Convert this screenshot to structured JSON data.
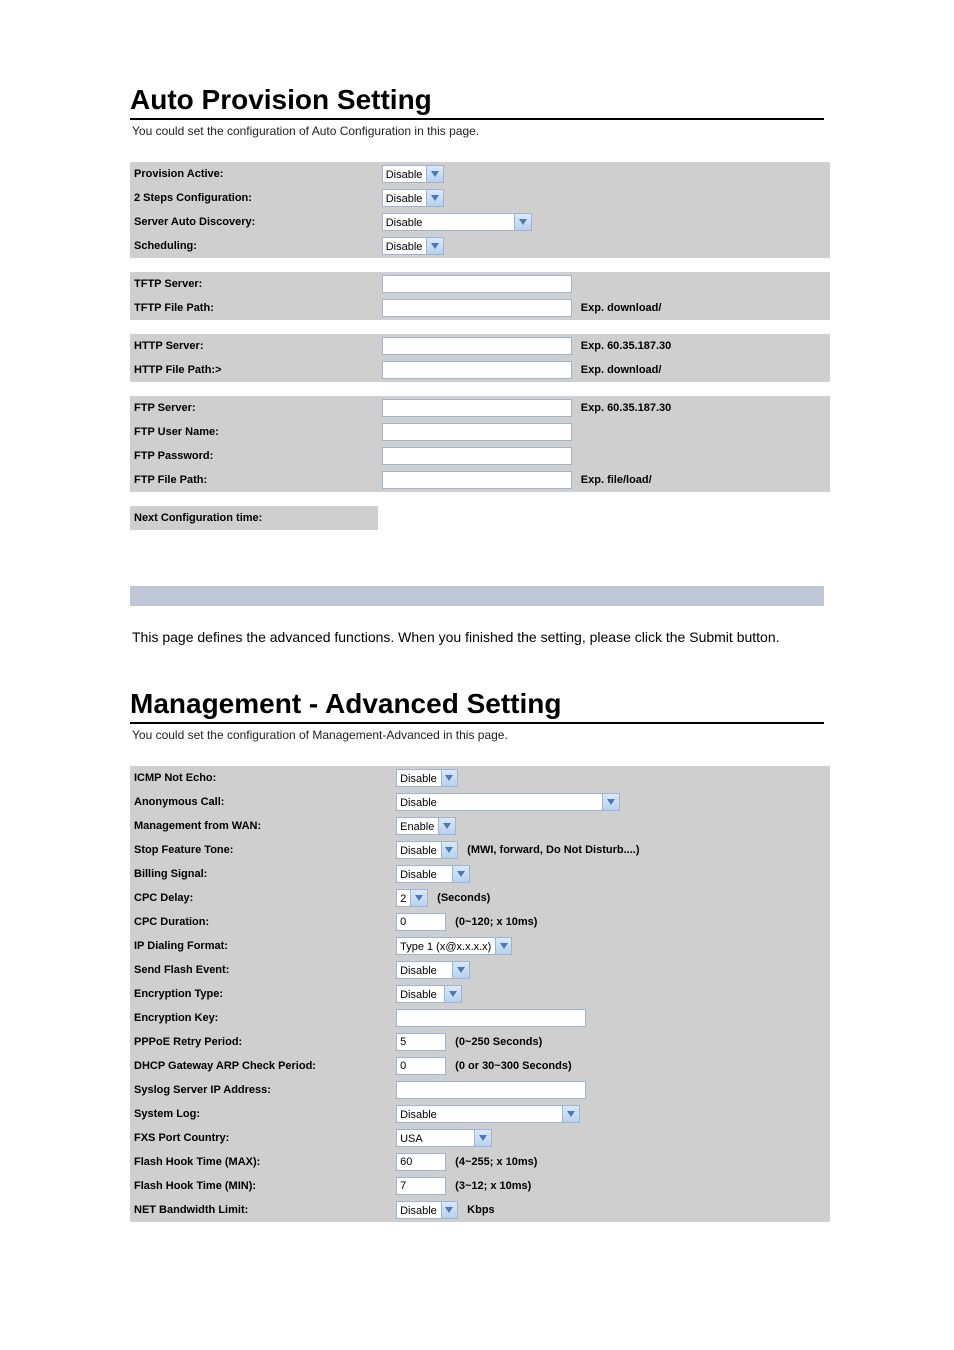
{
  "sections": {
    "autoProv": {
      "title": "Auto Provision Setting",
      "subtitle": "You could set the configuration of Auto Configuration in this page.",
      "rows": {
        "provisionActive": {
          "label": "Provision Active:",
          "select": "Disable"
        },
        "twoSteps": {
          "label": "2 Steps Configuration:",
          "select": "Disable"
        },
        "serverAutoDiscovery": {
          "label": "Server Auto Discovery:",
          "select": "Disable"
        },
        "scheduling": {
          "label": "Scheduling:",
          "select": "Disable"
        },
        "tftpServer": {
          "label": "TFTP Server:",
          "input": ""
        },
        "tftpFilePath": {
          "label": "TFTP File Path:",
          "input": "",
          "hint": "Exp. download/"
        },
        "httpServer": {
          "label": "HTTP Server:",
          "input": "",
          "hint": "Exp. 60.35.187.30"
        },
        "httpFilePath": {
          "label": "HTTP File Path:>",
          "input": "",
          "hint": "Exp. download/"
        },
        "ftpServer": {
          "label": "FTP Server:",
          "input": "",
          "hint": "Exp. 60.35.187.30"
        },
        "ftpUserName": {
          "label": "FTP User Name:",
          "input": ""
        },
        "ftpPassword": {
          "label": "FTP Password:",
          "input": ""
        },
        "ftpFilePath": {
          "label": "FTP File Path:",
          "input": "",
          "hint": "Exp. file/load/"
        },
        "nextConfigTime": {
          "label": "Next Configuration time:"
        }
      }
    },
    "intro": "This page defines the advanced functions. When you finished the setting, please click the Submit button.",
    "mgmtAdv": {
      "title": "Management - Advanced Setting",
      "subtitle": "You could set the configuration of Management-Advanced in this page.",
      "rows": {
        "icmpNotEcho": {
          "label": "ICMP Not Echo:",
          "select": "Disable"
        },
        "anonymousCall": {
          "label": "Anonymous Call:",
          "select": "Disable"
        },
        "mgmtFromWan": {
          "label": "Management from WAN:",
          "select": "Enable"
        },
        "stopFeatureTone": {
          "label": "Stop Feature Tone:",
          "select": "Disable",
          "hint": "(MWI, forward, Do Not Disturb....)"
        },
        "billingSignal": {
          "label": "Billing Signal:",
          "select": "Disable"
        },
        "cpcDelay": {
          "label": "CPC Delay:",
          "select": "2",
          "hint": "(Seconds)"
        },
        "cpcDuration": {
          "label": "CPC Duration:",
          "input": "0",
          "hint": "(0~120; x 10ms)"
        },
        "ipDialingFormat": {
          "label": "IP Dialing Format:",
          "select": "Type 1 (x@x.x.x.x)"
        },
        "sendFlashEvent": {
          "label": "Send Flash Event:",
          "select": "Disable"
        },
        "encryptionType": {
          "label": "Encryption Type:",
          "select": "Disable"
        },
        "encryptionKey": {
          "label": "Encryption Key:",
          "input": ""
        },
        "pppoeRetry": {
          "label": "PPPoE Retry Period:",
          "input": "5",
          "hint": "(0~250 Seconds)"
        },
        "dhcpGwArp": {
          "label": "DHCP Gateway ARP Check Period:",
          "input": "0",
          "hint": "(0 or 30~300 Seconds)"
        },
        "syslogIp": {
          "label": "Syslog Server IP Address:",
          "input": ""
        },
        "systemLog": {
          "label": "System Log:",
          "select": "Disable"
        },
        "fxsPortCountry": {
          "label": "FXS Port Country:",
          "select": "USA"
        },
        "flashHookMax": {
          "label": "Flash Hook Time (MAX):",
          "input": "60",
          "hint": "(4~255; x 10ms)"
        },
        "flashHookMin": {
          "label": "Flash Hook Time (MIN):",
          "input": "7",
          "hint": "(3~12; x 10ms)"
        },
        "netBwLimit": {
          "label": "NET Bandwidth Limit:",
          "select": "Disable",
          "hint": "Kbps"
        }
      }
    }
  }
}
